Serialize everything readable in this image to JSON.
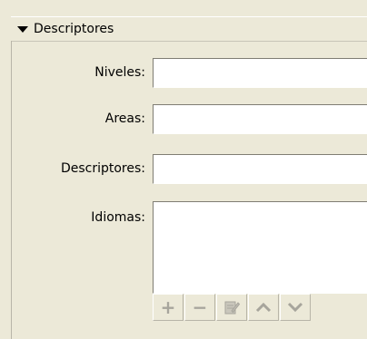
{
  "section": {
    "title": "Descriptores",
    "expanded": true
  },
  "fields": {
    "niveles_label": "Niveles:",
    "niveles_value": "",
    "areas_label": "Areas:",
    "areas_value": "",
    "descriptores_label": "Descriptores:",
    "descriptores_value": "",
    "idiomas_label": "Idiomas:",
    "idiomas_items": []
  },
  "toolbar": {
    "add_symbol": "+",
    "remove_symbol": "−",
    "icons": [
      "add-icon",
      "remove-icon",
      "edit-icon",
      "move-up-icon",
      "move-down-icon"
    ],
    "enabled": false
  }
}
